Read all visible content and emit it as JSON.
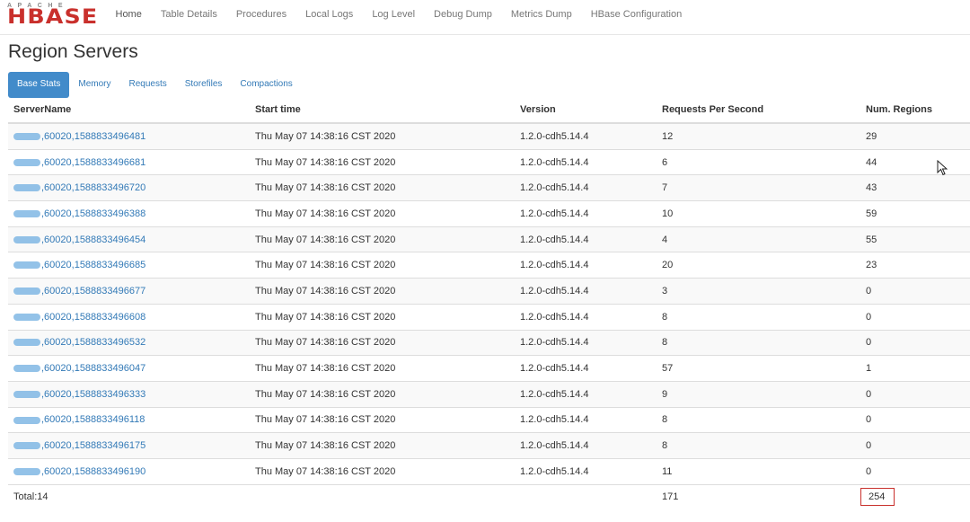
{
  "logo": {
    "small": "APACHE",
    "big": "HBASE"
  },
  "nav": [
    "Home",
    "Table Details",
    "Procedures",
    "Local Logs",
    "Log Level",
    "Debug Dump",
    "Metrics Dump",
    "HBase Configuration"
  ],
  "page_title": "Region Servers",
  "tabs": [
    "Base Stats",
    "Memory",
    "Requests",
    "Storefiles",
    "Compactions"
  ],
  "columns": [
    "ServerName",
    "Start time",
    "Version",
    "Requests Per Second",
    "Num. Regions"
  ],
  "rows": [
    {
      "server": ",60020,1588833496481",
      "start": "Thu May 07 14:38:16 CST 2020",
      "version": "1.2.0-cdh5.14.4",
      "rps": "12",
      "regions": "29"
    },
    {
      "server": ",60020,1588833496681",
      "start": "Thu May 07 14:38:16 CST 2020",
      "version": "1.2.0-cdh5.14.4",
      "rps": "6",
      "regions": "44"
    },
    {
      "server": ",60020,1588833496720",
      "start": "Thu May 07 14:38:16 CST 2020",
      "version": "1.2.0-cdh5.14.4",
      "rps": "7",
      "regions": "43"
    },
    {
      "server": ",60020,1588833496388",
      "start": "Thu May 07 14:38:16 CST 2020",
      "version": "1.2.0-cdh5.14.4",
      "rps": "10",
      "regions": "59"
    },
    {
      "server": ",60020,1588833496454",
      "start": "Thu May 07 14:38:16 CST 2020",
      "version": "1.2.0-cdh5.14.4",
      "rps": "4",
      "regions": "55"
    },
    {
      "server": ",60020,1588833496685",
      "start": "Thu May 07 14:38:16 CST 2020",
      "version": "1.2.0-cdh5.14.4",
      "rps": "20",
      "regions": "23"
    },
    {
      "server": ",60020,1588833496677",
      "start": "Thu May 07 14:38:16 CST 2020",
      "version": "1.2.0-cdh5.14.4",
      "rps": "3",
      "regions": "0"
    },
    {
      "server": ",60020,1588833496608",
      "start": "Thu May 07 14:38:16 CST 2020",
      "version": "1.2.0-cdh5.14.4",
      "rps": "8",
      "regions": "0"
    },
    {
      "server": ",60020,1588833496532",
      "start": "Thu May 07 14:38:16 CST 2020",
      "version": "1.2.0-cdh5.14.4",
      "rps": "8",
      "regions": "0"
    },
    {
      "server": ",60020,1588833496047",
      "start": "Thu May 07 14:38:16 CST 2020",
      "version": "1.2.0-cdh5.14.4",
      "rps": "57",
      "regions": "1"
    },
    {
      "server": ",60020,1588833496333",
      "start": "Thu May 07 14:38:16 CST 2020",
      "version": "1.2.0-cdh5.14.4",
      "rps": "9",
      "regions": "0"
    },
    {
      "server": ",60020,1588833496118",
      "start": "Thu May 07 14:38:16 CST 2020",
      "version": "1.2.0-cdh5.14.4",
      "rps": "8",
      "regions": "0"
    },
    {
      "server": ",60020,1588833496175",
      "start": "Thu May 07 14:38:16 CST 2020",
      "version": "1.2.0-cdh5.14.4",
      "rps": "8",
      "regions": "0"
    },
    {
      "server": ",60020,1588833496190",
      "start": "Thu May 07 14:38:16 CST 2020",
      "version": "1.2.0-cdh5.14.4",
      "rps": "11",
      "regions": "0"
    }
  ],
  "totals": {
    "label": "Total:14",
    "rps": "171",
    "regions": "254"
  },
  "colors": {
    "link": "#337ab7",
    "active_tab": "#428bca",
    "highlight_box": "#c9302c"
  }
}
